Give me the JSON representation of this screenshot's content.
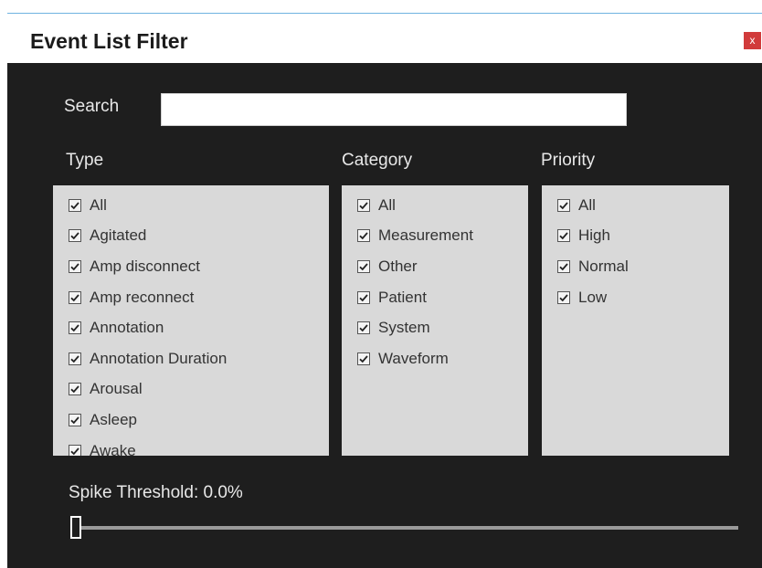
{
  "window": {
    "title": "Event List Filter",
    "close_label": "x"
  },
  "search": {
    "label": "Search",
    "value": "",
    "placeholder": ""
  },
  "type": {
    "label": "Type",
    "items": [
      {
        "label": "All",
        "checked": true
      },
      {
        "label": "Agitated",
        "checked": true
      },
      {
        "label": "Amp disconnect",
        "checked": true
      },
      {
        "label": "Amp reconnect",
        "checked": true
      },
      {
        "label": "Annotation",
        "checked": true
      },
      {
        "label": "Annotation Duration",
        "checked": true
      },
      {
        "label": "Arousal",
        "checked": true
      },
      {
        "label": "Asleep",
        "checked": true
      },
      {
        "label": "Awake",
        "checked": true
      }
    ]
  },
  "category": {
    "label": "Category",
    "items": [
      {
        "label": "All",
        "checked": true
      },
      {
        "label": "Measurement",
        "checked": true
      },
      {
        "label": "Other",
        "checked": true
      },
      {
        "label": "Patient",
        "checked": true
      },
      {
        "label": "System",
        "checked": true
      },
      {
        "label": "Waveform",
        "checked": true
      }
    ]
  },
  "priority": {
    "label": "Priority",
    "items": [
      {
        "label": "All",
        "checked": true
      },
      {
        "label": "High",
        "checked": true
      },
      {
        "label": "Normal",
        "checked": true
      },
      {
        "label": "Low",
        "checked": true
      }
    ]
  },
  "spike_threshold": {
    "label": "Spike Threshold: 0.0%",
    "value": 0.0
  },
  "colors": {
    "background": "#1e1e1e",
    "list_background": "#d9d9d9",
    "close_button": "#d13b3b",
    "accent_border": "#6fb3e0"
  }
}
